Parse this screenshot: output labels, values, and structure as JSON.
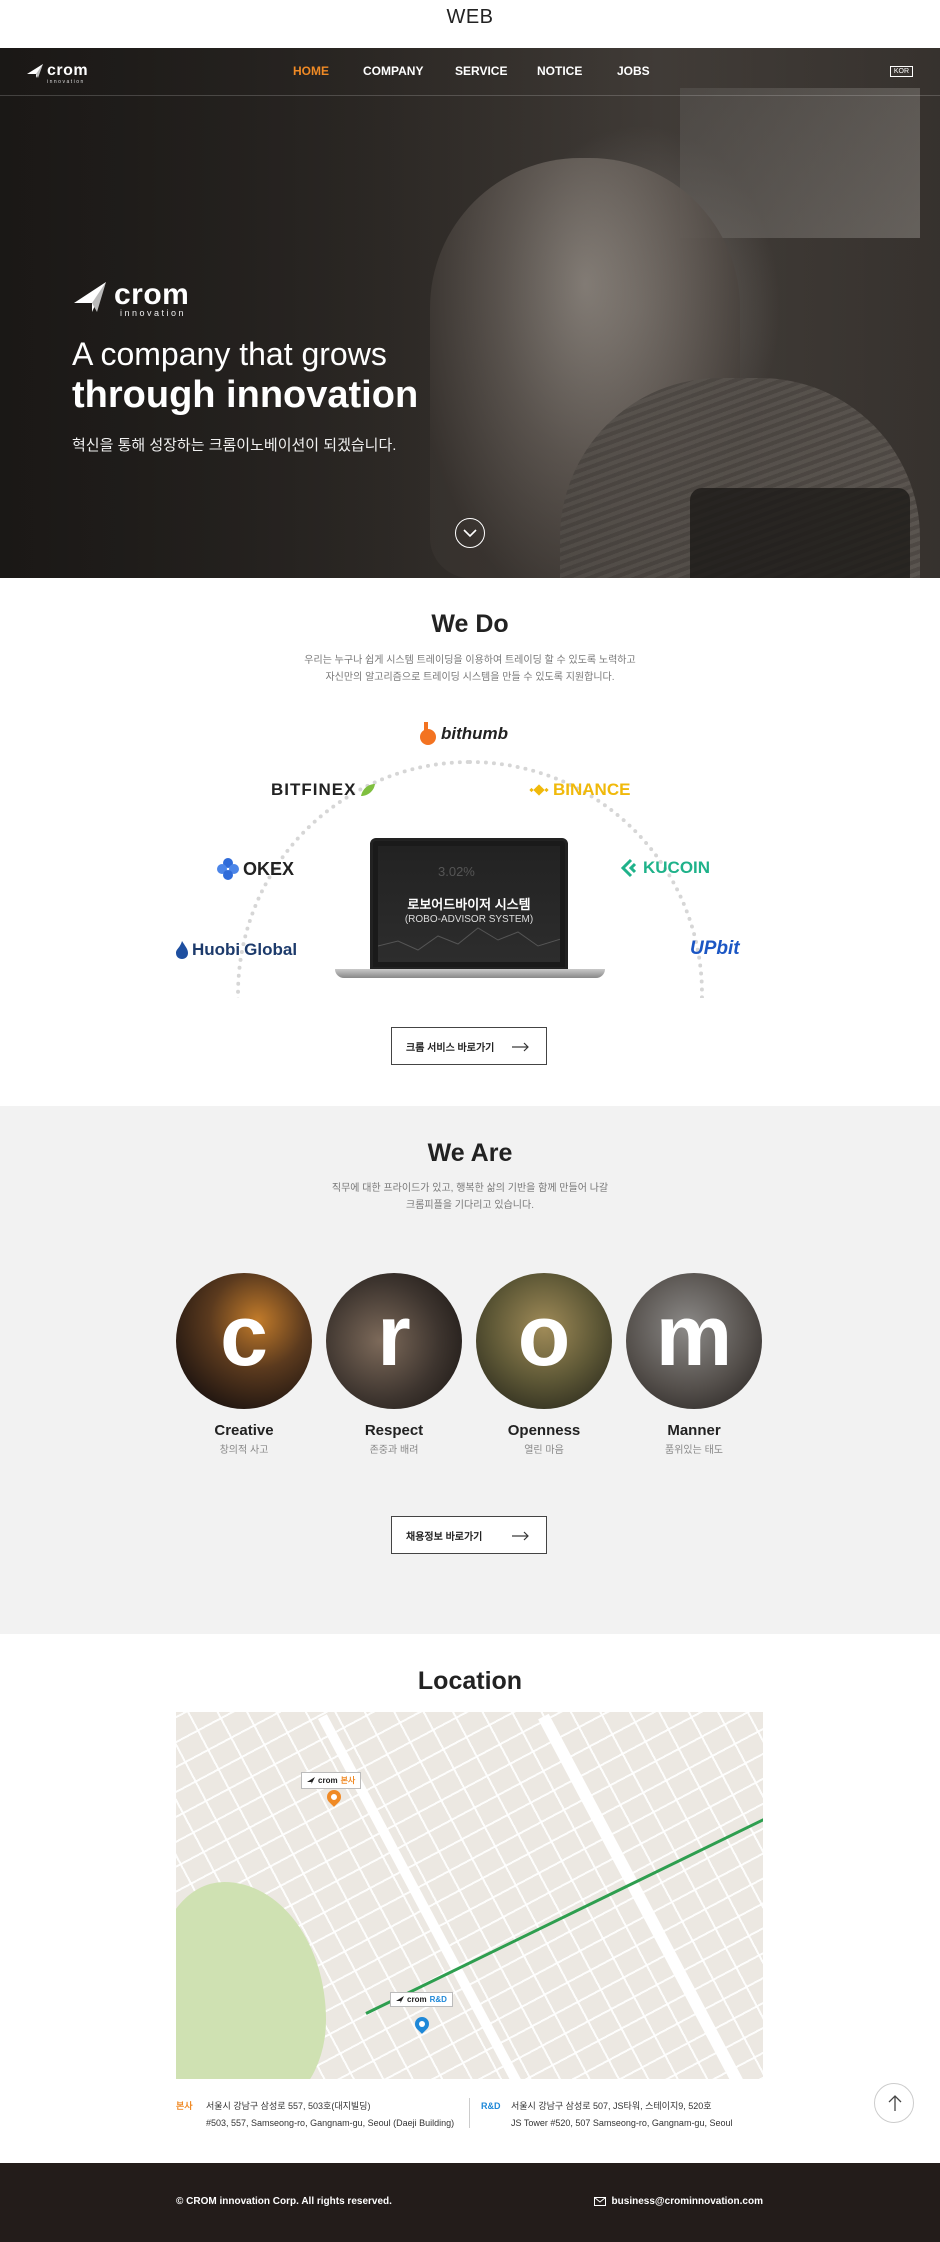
{
  "frame": {
    "title": "WEB"
  },
  "nav": {
    "logo": "crom",
    "logo_sub": "innovation",
    "items": [
      {
        "label": "HOME",
        "active": true
      },
      {
        "label": "COMPANY"
      },
      {
        "label": "SERVICE"
      },
      {
        "label": "NOTICE"
      },
      {
        "label": "JOBS"
      }
    ],
    "lang": "KOR",
    "accent": "#f08a25"
  },
  "hero": {
    "logo": "crom",
    "logo_sub": "innovation",
    "line1": "A company that grows",
    "line2": "through innovation",
    "sub": "혁신을 통해 성장하는 크롬이노베이션이 되겠습니다."
  },
  "wedo": {
    "title": "We Do",
    "desc1": "우리는 누구나 쉽게 시스템 트레이딩을 이용하여 트레이딩 할 수 있도록 노력하고",
    "desc2": "자신만의 알고리즘으로 트레이딩 시스템을 만들 수 있도록 지원합니다.",
    "exchanges": {
      "bithumb": "bithumb",
      "bitfinex": "BITFINEX",
      "binance": "BINANCE",
      "okex": "OKEX",
      "kucoin": "KUCOIN",
      "huobi_a": "Huobi",
      "huobi_b": "Global",
      "upbit": "UPbit"
    },
    "laptop_title": "로보어드바이저 시스템",
    "laptop_sub": "(ROBO-ADVISOR SYSTEM)",
    "laptop_pct": "3.02%",
    "button": "크롬 서비스 바로가기"
  },
  "weare": {
    "title": "We Are",
    "desc1": "직무에 대한 프라이드가 있고, 행복한 삶의 기반을 함께 만들어 나갈",
    "desc2": "크롬피플을 기다리고 있습니다.",
    "values": [
      {
        "letter": "c",
        "title": "Creative",
        "sub": "창의적 사고"
      },
      {
        "letter": "r",
        "title": "Respect",
        "sub": "존중과 배려"
      },
      {
        "letter": "o",
        "title": "Openness",
        "sub": "열린 마음"
      },
      {
        "letter": "m",
        "title": "Manner",
        "sub": "품위있는 태도"
      }
    ],
    "button": "채용정보 바로가기"
  },
  "location": {
    "title": "Location",
    "tag_hq": "본사",
    "tag_rd": "R&D",
    "tag_logo": "crom",
    "hq_label": "본사",
    "hq_line1": "서울시 강남구 삼성로 557, 503호(대지빌딩)",
    "hq_line2": "#503, 557, Samseong-ro, Gangnam-gu, Seoul (Daeji Building)",
    "rd_label": "R&D",
    "rd_line1": "서울시 강남구 삼성로 507, JS타워, 스테이지9, 520호",
    "rd_line2": "JS Tower #520, 507 Samseong-ro, Gangnam-gu, Seoul",
    "hq_color": "#f08a25",
    "rd_color": "#1e88d8"
  },
  "footer": {
    "copyright": "© CROM innovation Corp. All rights reserved.",
    "email": "business@crominnovation.com"
  }
}
